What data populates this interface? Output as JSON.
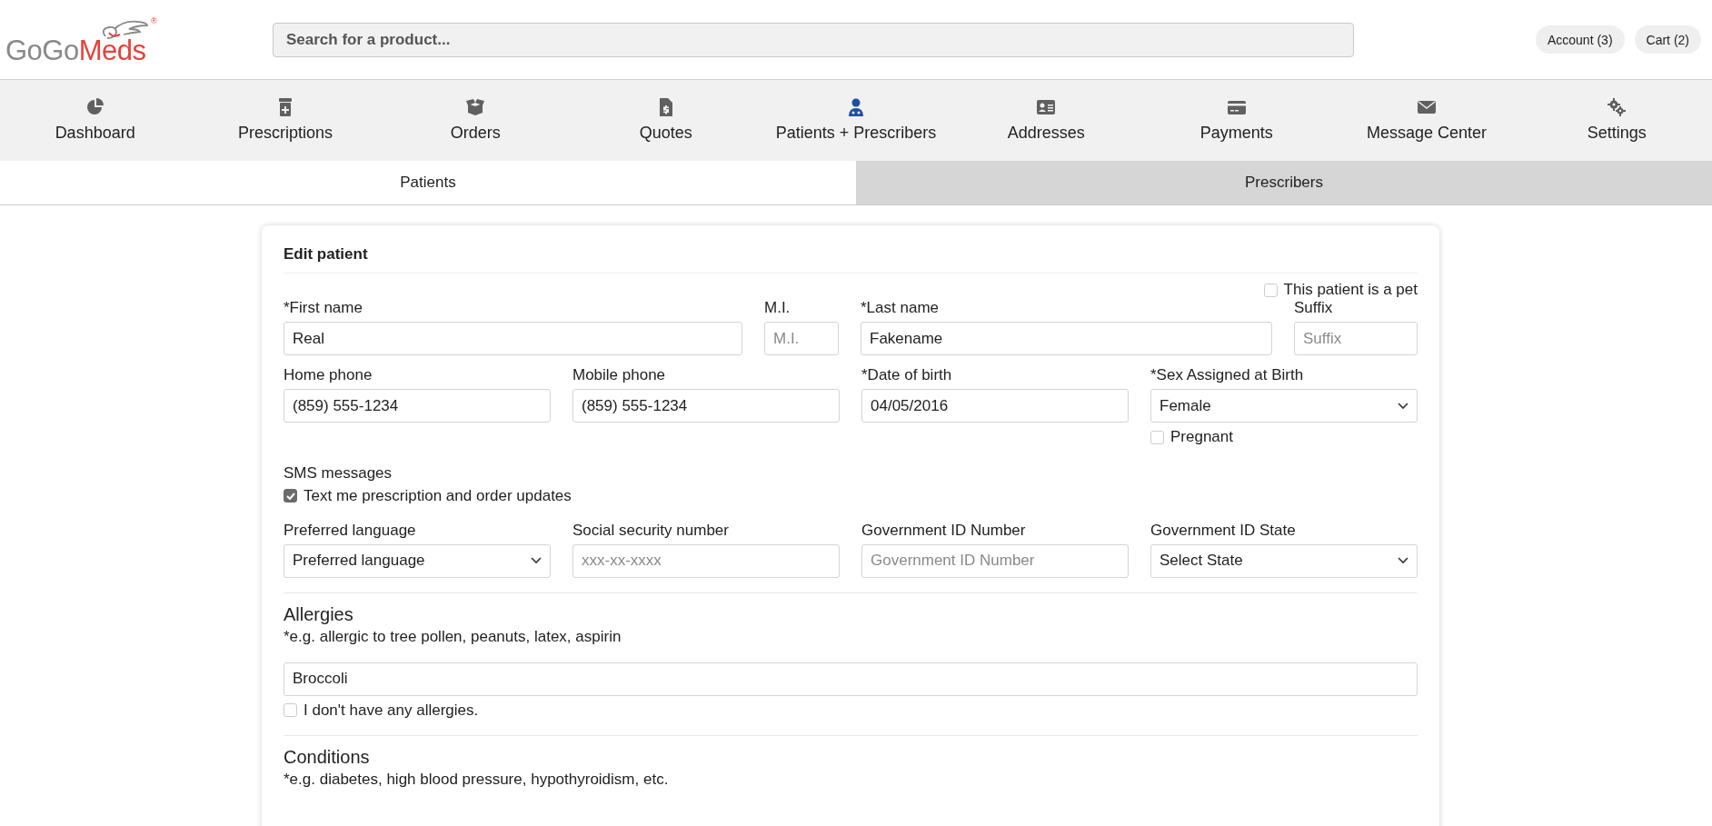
{
  "header": {
    "logo": {
      "brand_first": "GoGo",
      "brand_second": "Meds",
      "registered_mark": "®"
    },
    "search": {
      "placeholder": "Search for a product..."
    },
    "buttons": [
      "Account (3)",
      "Cart (2)"
    ]
  },
  "nav": [
    {
      "label": "Dashboard",
      "selected": false
    },
    {
      "label": "Prescriptions",
      "selected": false
    },
    {
      "label": "Orders",
      "selected": false
    },
    {
      "label": "Quotes",
      "selected": false
    },
    {
      "label": "Patients + Prescribers",
      "selected": true
    },
    {
      "label": "Addresses",
      "selected": false
    },
    {
      "label": "Payments",
      "selected": false
    },
    {
      "label": "Message Center",
      "selected": false
    },
    {
      "label": "Settings",
      "selected": false
    }
  ],
  "subtabs": [
    {
      "label": "Patients",
      "selected": true
    },
    {
      "label": "Prescribers",
      "selected": false
    }
  ],
  "form": {
    "title": "Edit patient",
    "pet_checkbox": {
      "label": "This patient is a pet",
      "checked": false
    },
    "rows": [
      {
        "kind": "name",
        "fields": [
          {
            "kind": "text",
            "label": "*First name",
            "value": "Real"
          },
          {
            "kind": "text",
            "label": "M.I.",
            "placeholder": "M.I."
          },
          {
            "kind": "text",
            "label": "*Last name",
            "value": "Fakename"
          },
          {
            "kind": "text",
            "label": "Suffix",
            "placeholder": "Suffix"
          }
        ]
      },
      {
        "kind": "standard",
        "fields": [
          {
            "kind": "text",
            "label": "Home phone",
            "value": "(859) 555-1234"
          },
          {
            "kind": "text",
            "label": "Mobile phone",
            "value": "(859) 555-1234"
          },
          {
            "kind": "text",
            "label": "*Date of birth",
            "value": "04/05/2016"
          },
          {
            "kind": "select",
            "label": "*Sex Assigned at Birth",
            "value": "Female",
            "checkbox": {
              "label": "Pregnant",
              "checked": false
            }
          }
        ]
      }
    ],
    "sms": {
      "label": "SMS messages",
      "checkbox": {
        "label": "Text me prescription and order updates",
        "checked": true
      }
    },
    "rows_2": [
      {
        "kind": "standard",
        "fields": [
          {
            "kind": "select",
            "label": "Preferred language",
            "value": "Preferred language"
          },
          {
            "kind": "text",
            "label": "Social security number",
            "placeholder": "xxx-xx-xxxx"
          },
          {
            "kind": "text",
            "label": "Government ID Number",
            "placeholder": "Government ID Number"
          },
          {
            "kind": "select",
            "label": "Government ID State",
            "value": "Select State"
          }
        ]
      }
    ],
    "allergies": {
      "heading": "Allergies",
      "hint": "*e.g. allergic to tree pollen, peanuts, latex, aspirin",
      "value": "Broccoli",
      "checkbox": {
        "label": "I don't have any allergies.",
        "checked": false
      }
    },
    "conditions": {
      "heading": "Conditions",
      "hint": "*e.g. diabetes, high blood pressure, hypothyroidism, etc."
    }
  }
}
